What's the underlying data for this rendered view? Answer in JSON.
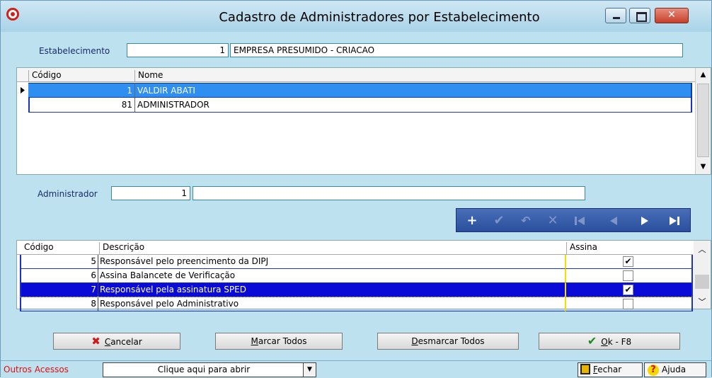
{
  "window": {
    "title": "Cadastro de Administradores por Estabelecimento"
  },
  "estab": {
    "label": "Estabelecimento",
    "code": "1",
    "name": "EMPRESA PRESUMIDO - CRIACAO"
  },
  "grid1": {
    "headers": [
      "Código",
      "Nome"
    ],
    "rows": [
      {
        "codigo": "1",
        "nome": "VALDIR ABATI"
      },
      {
        "codigo": "81",
        "nome": "ADMINISTRADOR"
      }
    ]
  },
  "admin": {
    "label": "Administrador",
    "code": "1",
    "name": ""
  },
  "grid2": {
    "headers": [
      "Código",
      "Descrição",
      "Assina"
    ],
    "rows": [
      {
        "codigo": "5",
        "descricao": "Responsável pelo preencimento da DIPJ",
        "assina": "✔"
      },
      {
        "codigo": "6",
        "descricao": "Assina Balancete de Verificação",
        "assina": ""
      },
      {
        "codigo": "7",
        "descricao": "Responsável pela assinatura SPED",
        "assina": "✔"
      },
      {
        "codigo": "8",
        "descricao": "Responsável pelo Administrativo",
        "assina": ""
      }
    ]
  },
  "buttons": {
    "cancelar": {
      "hot": "C",
      "rest": "ancelar"
    },
    "marcar": {
      "hot": "M",
      "rest": "arcar Todos"
    },
    "desmarcar": {
      "hot": "D",
      "rest": "esmarcar Todos"
    },
    "ok": {
      "hot": "O",
      "rest": "k - F8"
    }
  },
  "bottom": {
    "outros": "Outros Acessos",
    "combo": "Clique aqui para abrir",
    "fechar": {
      "hot": "F",
      "rest": "echar"
    },
    "ajuda": "Ajuda"
  }
}
